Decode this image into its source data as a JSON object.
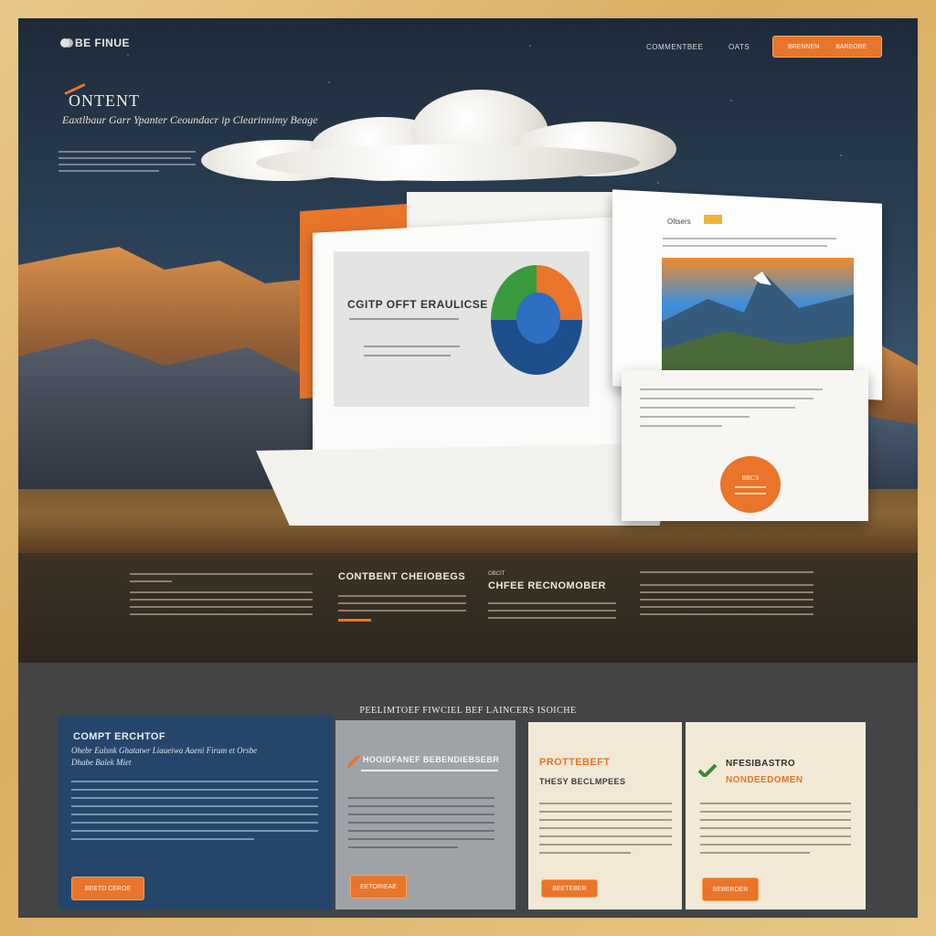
{
  "colors": {
    "accent": "#e8752a",
    "navy": "#24466a",
    "dark": "#2b3a4a"
  },
  "nav": {
    "brand": "BE FINUE",
    "links": [
      "COMMENTBEE",
      "OATS"
    ],
    "cta": [
      "BRENNEN",
      "BAREOBE"
    ]
  },
  "hero": {
    "title": "ONTENT",
    "subtitle": "Eaxtlbaur Garr  Ypanter  Ceoundacr ip Clearinnimy Beage"
  },
  "mockup": {
    "panel_title": "CGITP OFFT ERAULICSE",
    "right_label": "OItsers",
    "badge_label": "BBCS"
  },
  "features": {
    "col2_title": "CONTBENT CHEIOBEGS",
    "col3_label": "OBCIT",
    "col3_title": "CHFEE RECNOMOBER"
  },
  "bottom": {
    "heading": "PEELIMTOEF FIWCIEL BEF LAINCERS ISOICHE",
    "cards": [
      {
        "title": "COMPT ERCHTOF",
        "sub": "Ohebr Ealsnk  Ghatatwr  Liaueiwa  Aaeni  Firum  et  Orsbe",
        "sub2": "Dhabe Balek  Miet",
        "button": "BEETD CEROE"
      },
      {
        "title": "HOOIDFANEF BEBENDIEBSEBR",
        "button": "EETORIEAE"
      },
      {
        "title": "PROTTEBEFT",
        "sub": "THESY BECLMPEES",
        "button": "BEETEBER"
      },
      {
        "title": "NFESIBASTRO",
        "sub": "NONDEEDOMEN",
        "button": "BEBERDER"
      }
    ]
  }
}
